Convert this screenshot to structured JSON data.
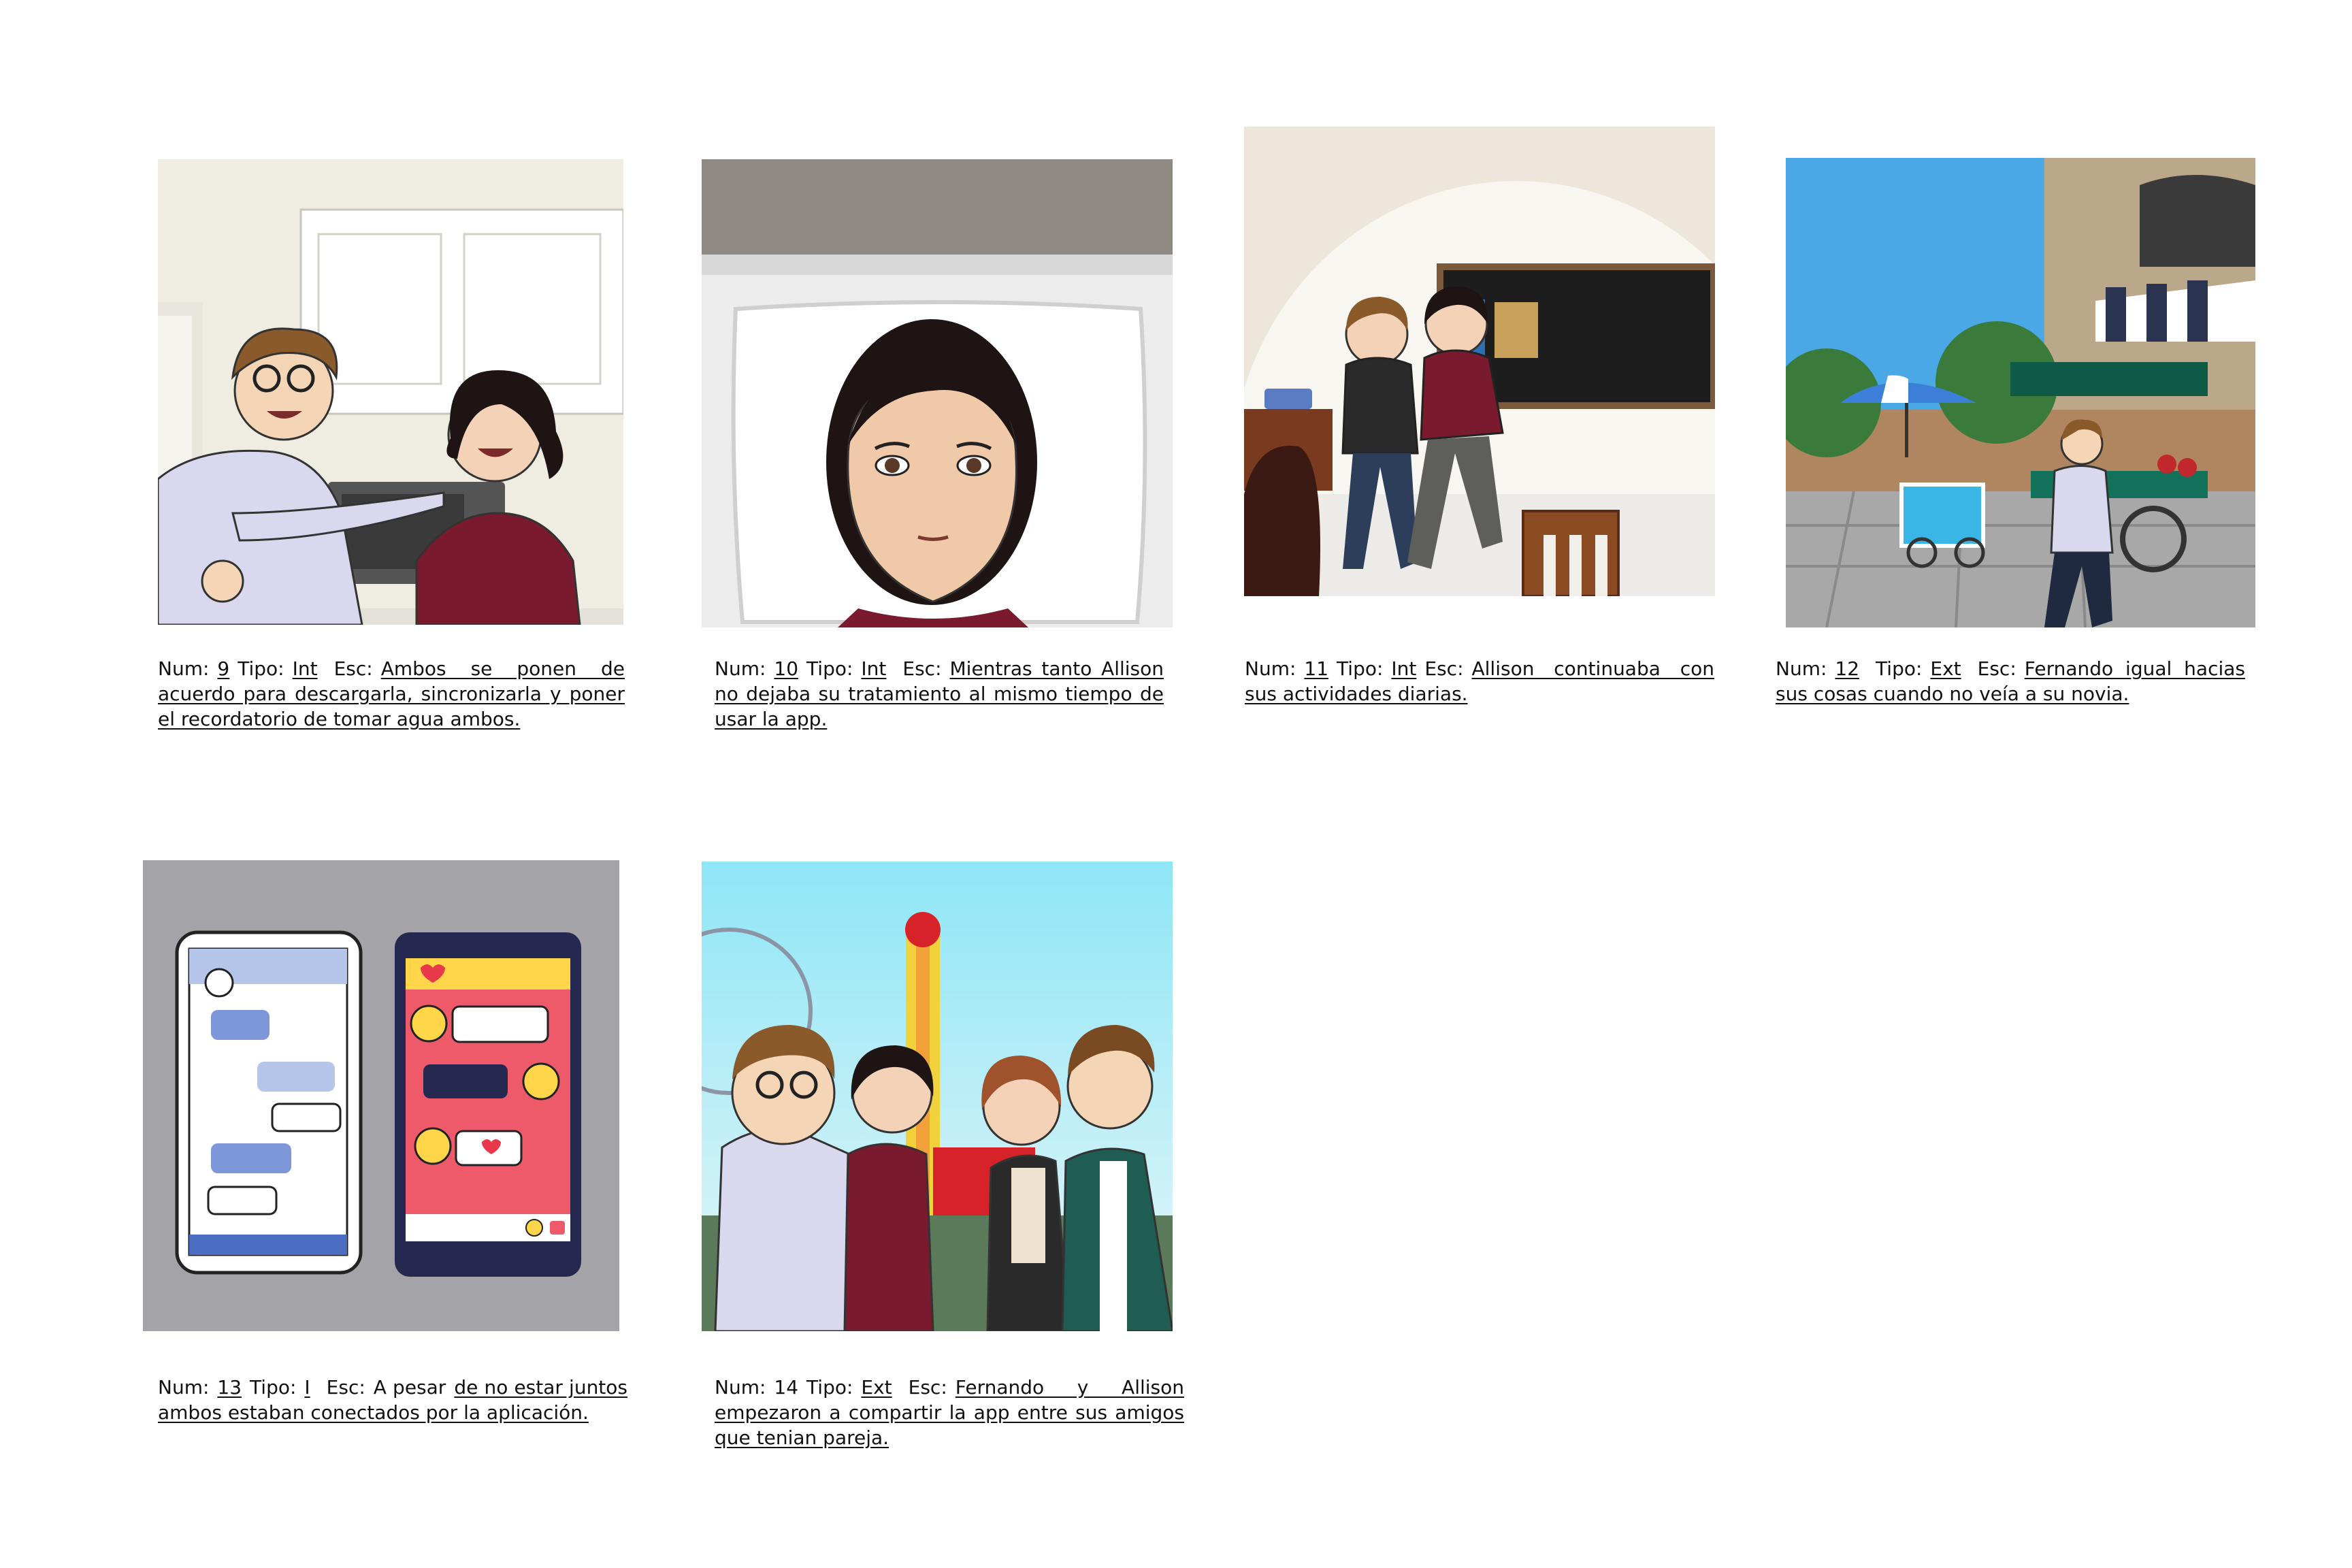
{
  "captions": [
    {
      "num_label": "Num:",
      "num": "9",
      "tipo_label": "Tipo:",
      "tipo": "Int",
      "esc_label": "Esc:",
      "esc": "Ambos se ponen de acuerdo para descargarla, sincronizarla y poner el recordatorio de tomar agua ambos."
    },
    {
      "num_label": "Num:",
      "num": "10",
      "tipo_label": "Tipo:",
      "tipo": "Int",
      "esc_label": "Esc:",
      "esc": "Mientras tanto Allison no dejaba su tratamiento al mismo tiempo de usar la app."
    },
    {
      "num_label": "Num:",
      "num": "11",
      "tipo_label": "Tipo:",
      "tipo": "Int",
      "esc_label": "Esc:",
      "esc": "Allison continuaba con sus actividades diarias."
    },
    {
      "num_label": "Num:",
      "num": "12",
      "tipo_label": "Tipo:",
      "tipo": "Ext",
      "esc_label": "Esc:",
      "esc": "Fernando igual hacias sus cosas cuando no veía a su novia."
    },
    {
      "num_label": "Num:",
      "num": "13",
      "tipo_label": "Tipo:",
      "tipo": "I",
      "esc_label": "Esc:",
      "esc_plain": "A pesar",
      "esc": "de no estar juntos ambos estaban conectados por la aplicación."
    },
    {
      "num_label": "Num:",
      "num": "14",
      "tipo_label": "Tipo:",
      "tipo": "Ext",
      "esc_label": "Esc:",
      "esc": "Fernando y Allison empezaron a compartir la app entre sus amigos que tenian pareja."
    }
  ],
  "panels": [
    {
      "scene": "kitchen"
    },
    {
      "scene": "pillow"
    },
    {
      "scene": "classroom"
    },
    {
      "scene": "street"
    },
    {
      "scene": "phones"
    },
    {
      "scene": "fair"
    }
  ],
  "colors": {
    "shirt_lavender": "#d9d8ee",
    "shirt_maroon": "#7a1a2e",
    "hair_brown": "#8a5a2b",
    "hair_dark": "#1e1414",
    "sky_blue": "#4aa8e6",
    "phone_pink": "#ef5a6a",
    "phone_navy": "#26294f",
    "bg_grey": "#a4a3a8"
  }
}
